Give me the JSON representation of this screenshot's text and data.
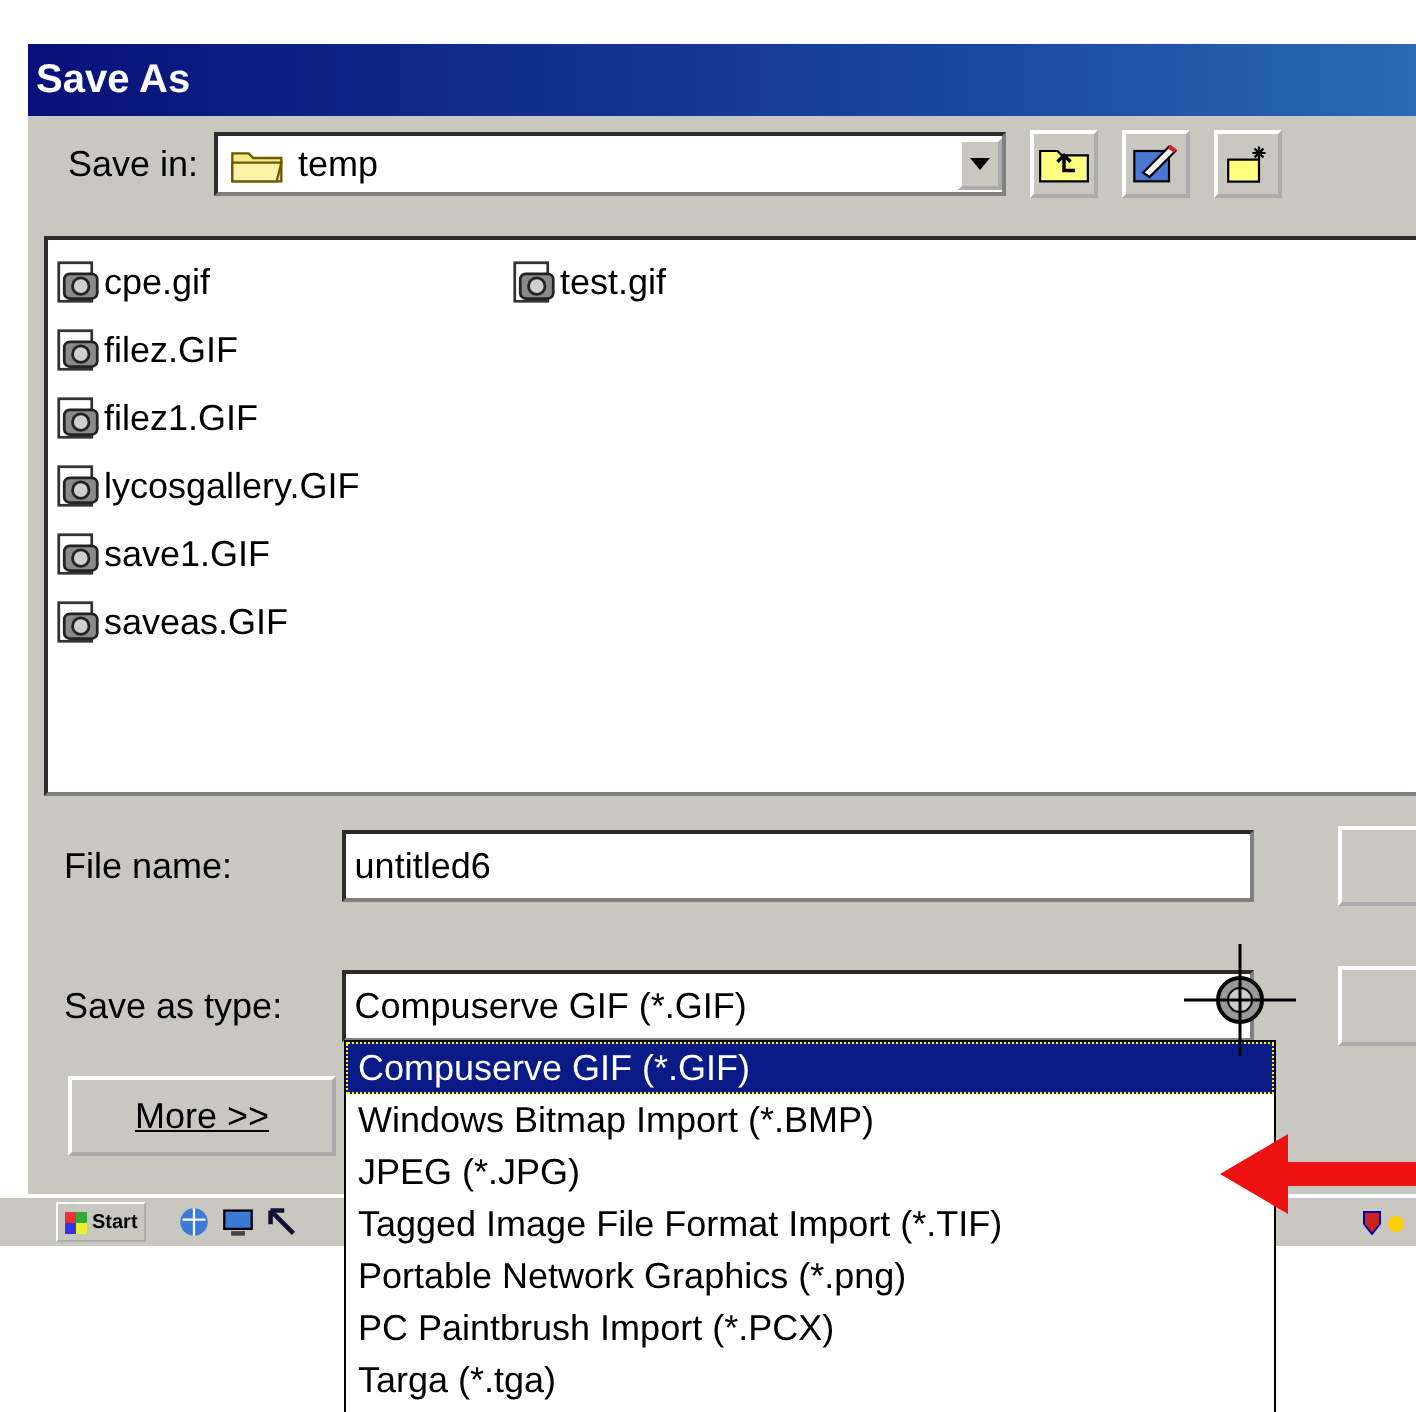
{
  "window": {
    "title": "Save As"
  },
  "save_in": {
    "label": "Save in:",
    "value": "temp"
  },
  "files": [
    {
      "name": "cpe.gif"
    },
    {
      "name": "filez.GIF"
    },
    {
      "name": "filez1.GIF"
    },
    {
      "name": "lycosgallery.GIF"
    },
    {
      "name": "save1.GIF"
    },
    {
      "name": "saveas.GIF"
    },
    {
      "name": "test.gif"
    }
  ],
  "file_name": {
    "label": "File name:",
    "value": "untitled6"
  },
  "save_as_type": {
    "label": "Save as type:",
    "value": "Compuserve GIF (*.GIF)",
    "expanded": true,
    "options": [
      {
        "label": "Compuserve GIF (*.GIF)",
        "selected": true
      },
      {
        "label": "Windows Bitmap Import (*.BMP)",
        "selected": false
      },
      {
        "label": "JPEG (*.JPG)",
        "selected": false
      },
      {
        "label": "Tagged Image File Format Import (*.TIF)",
        "selected": false
      },
      {
        "label": "Portable Network Graphics (*.png)",
        "selected": false
      },
      {
        "label": "PC Paintbrush Import (*.PCX)",
        "selected": false
      },
      {
        "label": "Targa (*.tga)",
        "selected": false
      }
    ]
  },
  "more_button": "More >>",
  "taskbar": {
    "start": "Start"
  }
}
